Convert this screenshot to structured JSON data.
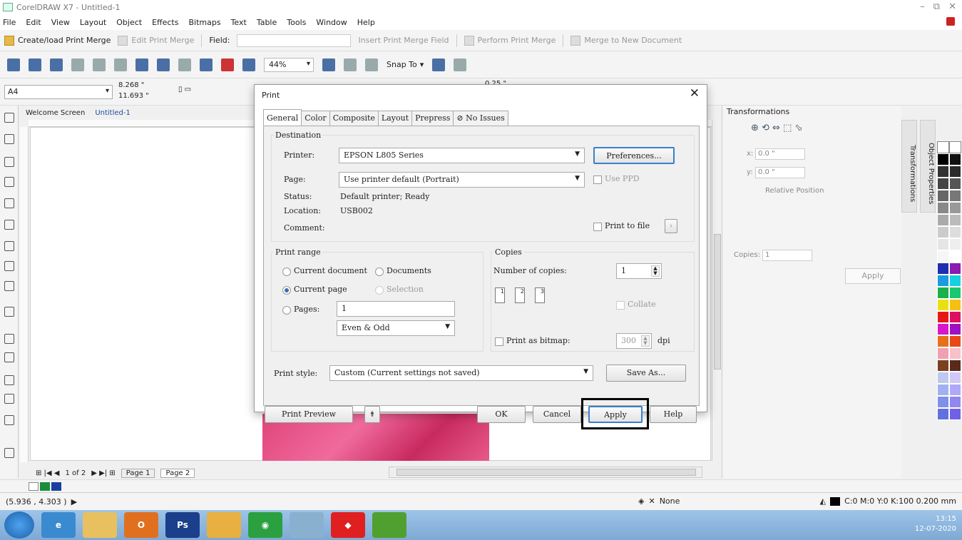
{
  "window": {
    "title": "CorelDRAW X7 - Untitled-1",
    "min": "–",
    "restore": "⧉",
    "close": "✕"
  },
  "menu": [
    "File",
    "Edit",
    "View",
    "Layout",
    "Object",
    "Effects",
    "Bitmaps",
    "Text",
    "Table",
    "Tools",
    "Window",
    "Help"
  ],
  "print_merge_bar": {
    "create_load": "Create/load Print Merge",
    "edit": "Edit Print Merge",
    "field_label": "Field:",
    "insert_field": "Insert Print Merge Field",
    "perform": "Perform Print Merge",
    "merge_new": "Merge to New Document"
  },
  "standard_bar": {
    "zoom": "44%",
    "snap_to": "Snap To"
  },
  "property_bar": {
    "page_size": "A4",
    "width": "8.268 \"",
    "height": "11.693 \"",
    "nudge": "0.25 \""
  },
  "doc_tabs": [
    "Welcome Screen",
    "Untitled-1"
  ],
  "page_nav": {
    "counter": "1 of 2",
    "pages": [
      "Page 1",
      "Page 2"
    ]
  },
  "status": {
    "coords": "(5.936 , 4.303 )",
    "fill_none": "None",
    "outline": "C:0 M:0 Y:0 K:100  0.200 mm"
  },
  "docker": {
    "title": "Transformations",
    "x_label": "x:",
    "x_value": "0.0 \"",
    "y_label": "y:",
    "y_value": "0.0 \"",
    "relative_position": "Relative Position",
    "copies_label": "Copies:",
    "copies_value": "1",
    "apply": "Apply",
    "tab_transformations": "Transformations",
    "tab_object_properties": "Object Properties"
  },
  "print_dialog": {
    "title": "Print",
    "close": "✕",
    "tabs": [
      "General",
      "Color",
      "Composite",
      "Layout",
      "Prepress",
      "No Issues"
    ],
    "destination": {
      "legend": "Destination",
      "printer_label": "Printer:",
      "printer_value": "EPSON L805 Series",
      "preferences": "Preferences...",
      "page_label": "Page:",
      "page_value": "Use printer default (Portrait)",
      "use_ppd": "Use PPD",
      "status_label": "Status:",
      "status_value": "Default printer; Ready",
      "location_label": "Location:",
      "location_value": "USB002",
      "comment_label": "Comment:",
      "print_to_file": "Print to file"
    },
    "print_range": {
      "legend": "Print range",
      "current_document": "Current document",
      "documents": "Documents",
      "current_page": "Current page",
      "selection": "Selection",
      "pages_label": "Pages:",
      "pages_value": "1",
      "even_odd": "Even & Odd"
    },
    "copies": {
      "legend": "Copies",
      "number_label": "Number of copies:",
      "number_value": "1",
      "collate": "Collate",
      "print_as_bitmap": "Print as bitmap:",
      "dpi_value": "300",
      "dpi_label": "dpi"
    },
    "print_style_label": "Print style:",
    "print_style_value": "Custom (Current settings not saved)",
    "save_as": "Save As...",
    "buttons": {
      "preview": "Print Preview",
      "ok": "OK",
      "cancel": "Cancel",
      "apply": "Apply",
      "help": "Help"
    }
  },
  "tray": {
    "time": "13:15",
    "date": "12-07-2020"
  },
  "colors": {
    "accent": "#3c7fc8",
    "highlight": "#000000"
  }
}
